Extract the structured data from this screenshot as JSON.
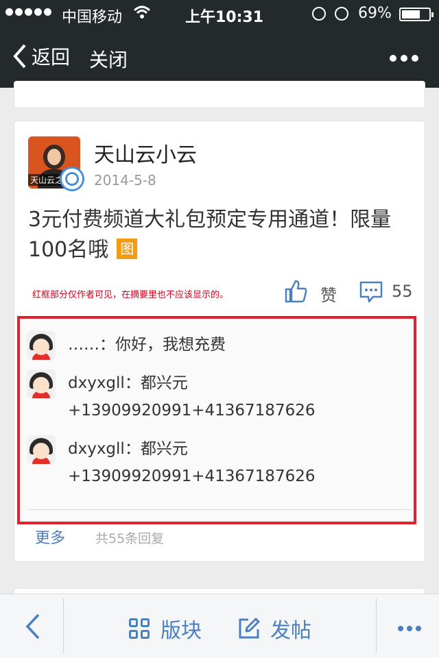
{
  "status_bar": {
    "carrier": "中国移动",
    "time": "上午10:31",
    "battery_percent": "69%",
    "battery_level": 0.69
  },
  "nav": {
    "back_label": "返回",
    "close_label": "关闭"
  },
  "post": {
    "author": "天山云小云",
    "avatar_logo": "天山云之",
    "date": "2014-5-8",
    "title": "3元付费频道大礼包预定专用通道！限量100名哦",
    "image_tag": "图",
    "note": "红框部分仅作者可见，在摘要里也不应该显示的。",
    "like_label": "赞",
    "comment_count": "55",
    "replies": [
      {
        "user": "……",
        "text": "：你好，我想充费"
      },
      {
        "user": "dxyxgll",
        "text": "：都兴元+13909920991+41367187626"
      },
      {
        "user": "dxyxgll",
        "text": "：都兴元+13909920991+41367187626"
      }
    ],
    "more_label": "更多",
    "reply_total": "共55条回复"
  },
  "toolbar": {
    "board_label": "版块",
    "post_label": "发帖"
  }
}
